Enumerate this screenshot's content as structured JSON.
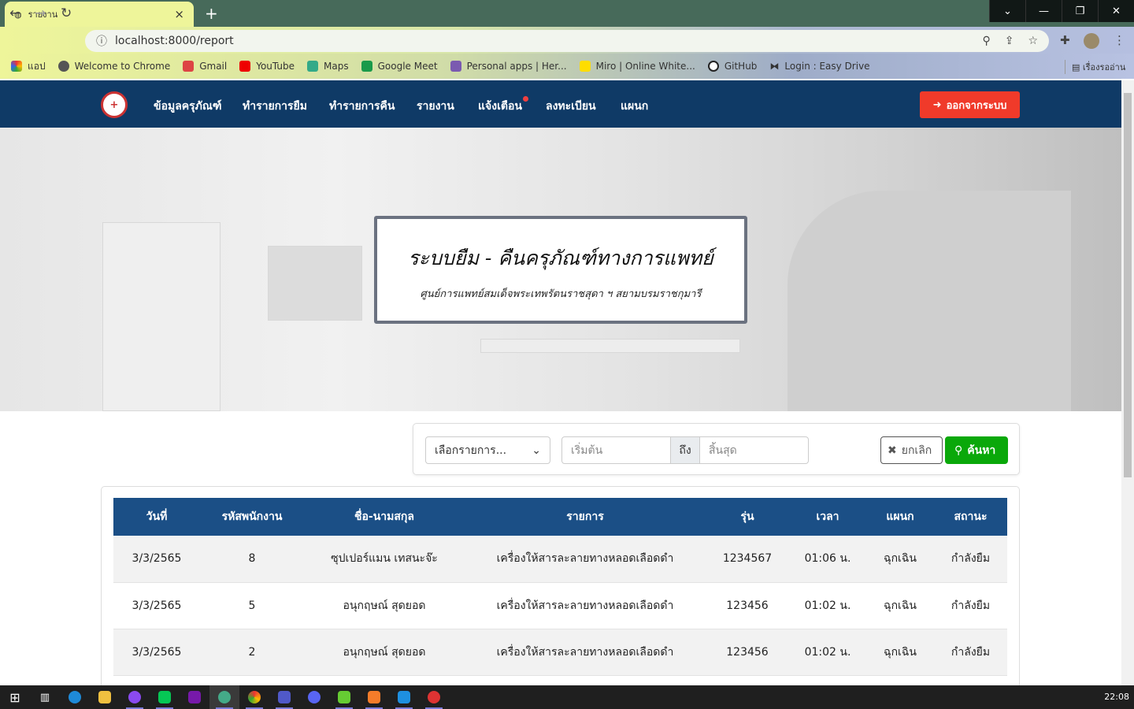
{
  "browser": {
    "tab_title": "รายงาน",
    "url": "localhost:8000/report",
    "bookmarks": [
      "แอป",
      "Welcome to Chrome",
      "Gmail",
      "YouTube",
      "Maps",
      "Google Meet",
      "Personal apps | Her...",
      "Miro | Online White...",
      "GitHub",
      "Login : Easy Drive"
    ],
    "reading_list": "เรื่องรออ่าน"
  },
  "nav": {
    "items": [
      "ข้อมูลครุภัณฑ์",
      "ทำรายการยืม",
      "ทำรายการคืน",
      "รายงาน",
      "แจ้งเตือน",
      "ลงทะเบียน",
      "แผนก"
    ],
    "logout": "ออกจากระบบ"
  },
  "hero": {
    "title": "ระบบยืม - คืนครุภัณฑ์ทางการแพทย์",
    "subtitle": "ศูนย์การแพทย์สมเด็จพระเทพรัตนราชสุดา ฯ สยามบรมราชกุมารี"
  },
  "filter": {
    "select": "เลือกรายการ...",
    "start_placeholder": "เริ่มต้น",
    "to": "ถึง",
    "end_placeholder": "สิ้นสุด",
    "cancel": "ยกเลิก",
    "search": "ค้นหา"
  },
  "table": {
    "headers": [
      "วันที่",
      "รหัสพนักงาน",
      "ชื่อ-นามสกุล",
      "รายการ",
      "รุ่น",
      "เวลา",
      "แผนก",
      "สถานะ"
    ],
    "rows": [
      [
        "3/3/2565",
        "8",
        "ซุปเปอร์แมน เทสนะจ๊ะ",
        "เครื่องให้สารละลายทางหลอดเลือดดำ",
        "1234567",
        "01:06 น.",
        "ฉุกเฉิน",
        "กำลังยืม"
      ],
      [
        "3/3/2565",
        "5",
        "อนุกฤษณ์ สุดยอด",
        "เครื่องให้สารละลายทางหลอดเลือดดำ",
        "123456",
        "01:02 น.",
        "ฉุกเฉิน",
        "กำลังยืม"
      ],
      [
        "3/3/2565",
        "2",
        "อนุกฤษณ์ สุดยอด",
        "เครื่องให้สารละลายทางหลอดเลือดดำ",
        "123456",
        "01:02 น.",
        "ฉุกเฉิน",
        "กำลังยืม"
      ]
    ]
  },
  "taskbar": {
    "clock": "22:08"
  }
}
